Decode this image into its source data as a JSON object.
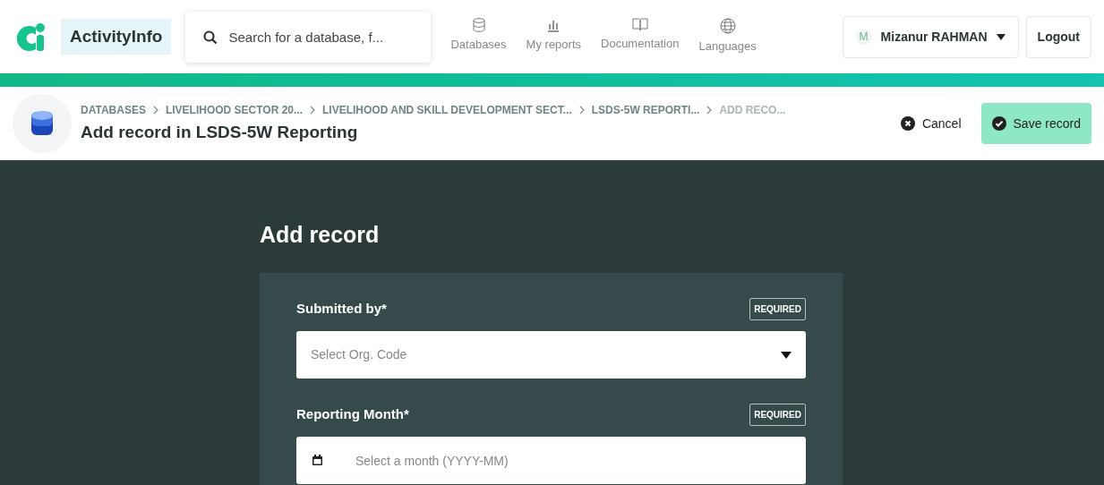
{
  "brand": "ActivityInfo",
  "search": {
    "placeholder": "Search for a database, f..."
  },
  "nav": [
    {
      "kind": "database",
      "label": "Databases"
    },
    {
      "kind": "reports",
      "label": "My reports"
    },
    {
      "kind": "book",
      "label": "Documentation"
    },
    {
      "kind": "globe",
      "label": "Languages"
    }
  ],
  "user": {
    "initial": "M",
    "name": "Mizanur RAHMAN"
  },
  "logout": "Logout",
  "breadcrumb": [
    {
      "label": "DATABASES",
      "current": false
    },
    {
      "label": "LIVELIHOOD SECTOR 20...",
      "current": false
    },
    {
      "label": "LIVELIHOOD AND SKILL DEVELOPMENT SECT...",
      "current": false
    },
    {
      "label": "LSDS-5W REPORTI...",
      "current": false
    },
    {
      "label": "ADD RECO...",
      "current": true
    }
  ],
  "page_title": "Add record in LSDS-5W Reporting",
  "cancel": "Cancel",
  "save": "Save record",
  "form_title": "Add record",
  "fields": [
    {
      "kind": "select",
      "label": "Submitted by*",
      "badge": "REQUIRED",
      "placeholder": "Select Org. Code"
    },
    {
      "kind": "month",
      "label": "Reporting Month*",
      "badge": "REQUIRED",
      "placeholder": "Select a month (YYYY-MM)"
    }
  ]
}
